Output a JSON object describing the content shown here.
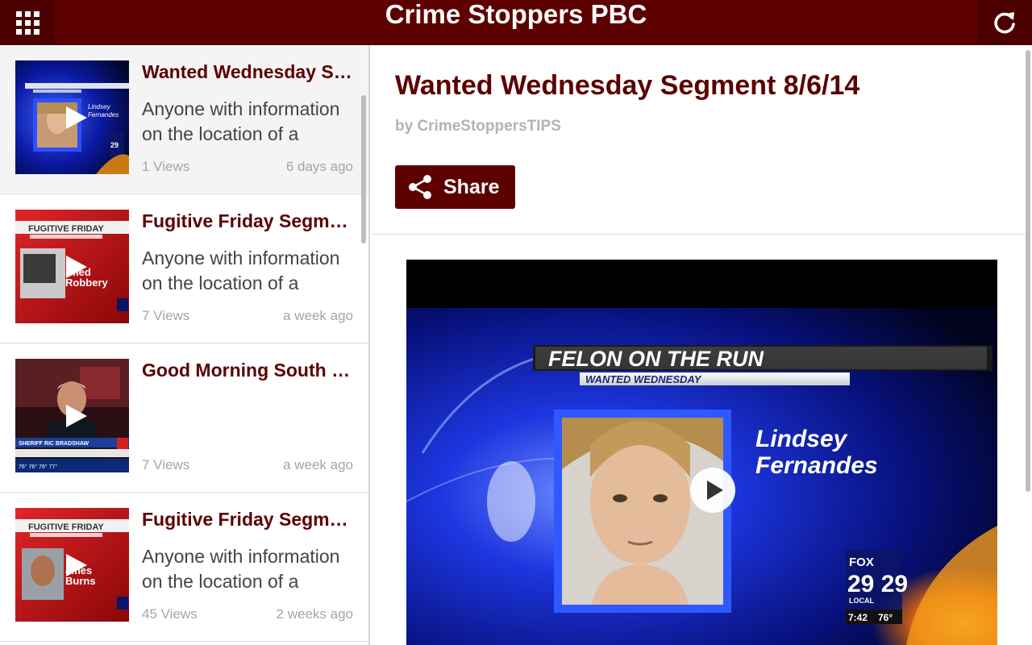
{
  "app": {
    "title": "Crime Stoppers PBC"
  },
  "videos": [
    {
      "title": "Wanted Wednesday Segment 8/6/14",
      "description": "Anyone with information on the location of a",
      "views": "1 Views",
      "age": "6 days ago",
      "thumb_banner": "FELON ON THE RUN",
      "thumb_name": "Lindsey Fernandes"
    },
    {
      "title": "Fugitive Friday Segment",
      "description": "Anyone with information on the location of a",
      "views": "7 Views",
      "age": "a week ago",
      "thumb_banner": "FUGITIVE FRIDAY",
      "thumb_name": "Armed Robbery"
    },
    {
      "title": "Good Morning South Florida",
      "description": "",
      "views": "7 Views",
      "age": "a week ago",
      "thumb_banner": "SHERIFF RIC BRADSHAW",
      "thumb_name": ""
    },
    {
      "title": "Fugitive Friday Segment",
      "description": "Anyone with information on the location of a",
      "views": "45 Views",
      "age": "2 weeks ago",
      "thumb_banner": "FUGITIVE FRIDAY",
      "thumb_name": "James Burns"
    }
  ],
  "detail": {
    "title": "Wanted Wednesday Segment 8/6/14",
    "byline": "by CrimeStoppersTIPS",
    "share_label": "Share",
    "video": {
      "banner": "FELON ON THE RUN",
      "subbanner": "WANTED WEDNESDAY",
      "name_line1": "Lindsey",
      "name_line2": "Fernandes",
      "logo_network": "FOX",
      "logo_channel": "29 29",
      "logo_local": "LOCAL",
      "clock": "7:42",
      "temperature": "76°"
    }
  },
  "colors": {
    "brand": "#5c0000",
    "muted": "#a5a5a5"
  },
  "icons": {
    "menu": "grid-icon",
    "refresh": "refresh-icon",
    "share": "share-icon",
    "play": "play-icon"
  }
}
